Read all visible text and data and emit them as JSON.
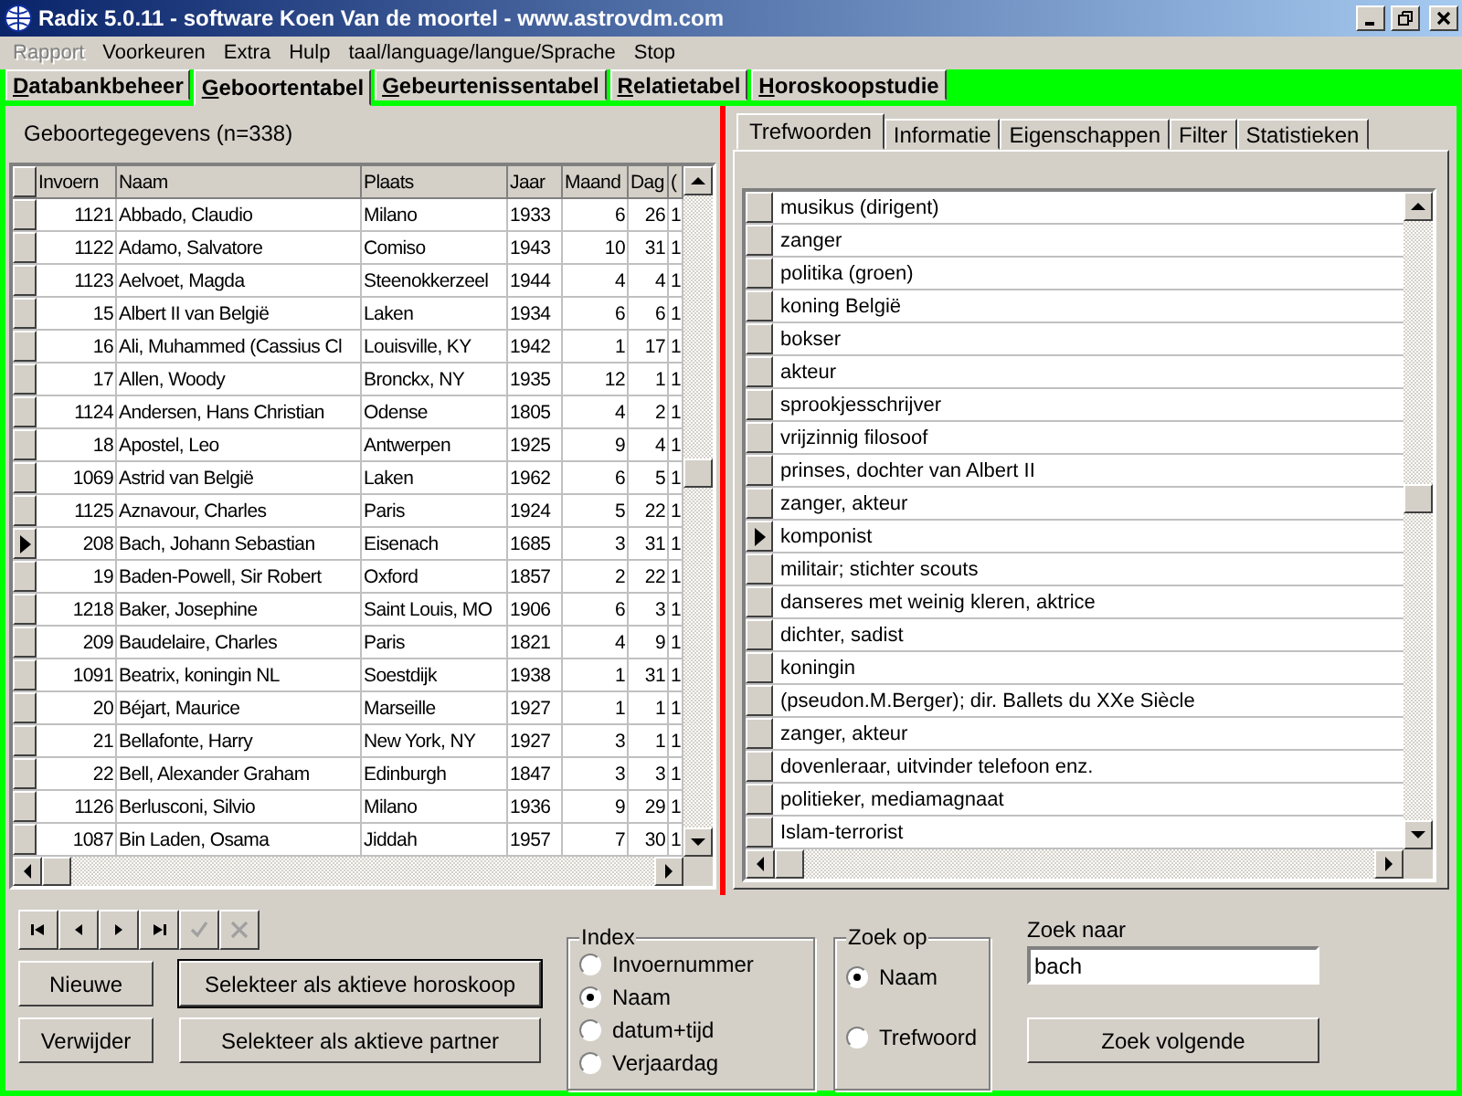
{
  "window": {
    "title": "Radix 5.0.11 - software Koen Van de moortel - www.astrovdm.com"
  },
  "menu": [
    {
      "label": "Rapport",
      "disabled": true
    },
    {
      "label": "Voorkeuren",
      "disabled": false
    },
    {
      "label": "Extra",
      "disabled": false
    },
    {
      "label": "Hulp",
      "disabled": false
    },
    {
      "label": "taal/language/langue/Sprache",
      "disabled": false
    },
    {
      "label": "Stop",
      "disabled": false
    }
  ],
  "main_tabs": [
    {
      "label": "Databankbeheer",
      "selected": false
    },
    {
      "label": "Geboortentabel",
      "selected": true
    },
    {
      "label": "Gebeurtenissentabel",
      "selected": false
    },
    {
      "label": "Relatietabel",
      "selected": false
    },
    {
      "label": "Horoskoopstudie",
      "selected": false
    }
  ],
  "birth_panel": {
    "title": "Geboortegegevens (n=338)",
    "columns": [
      "Invoern",
      "Naam",
      "Plaats",
      "Jaar",
      "Maand",
      "Dag",
      "("
    ],
    "rows": [
      {
        "selected": false,
        "cells": [
          "1121",
          "Abbado, Claudio",
          "Milano",
          "1933",
          "6",
          "26",
          "1"
        ]
      },
      {
        "selected": false,
        "cells": [
          "1122",
          "Adamo, Salvatore",
          "Comiso",
          "1943",
          "10",
          "31",
          "1"
        ]
      },
      {
        "selected": false,
        "cells": [
          "1123",
          "Aelvoet, Magda",
          "Steenokkerzeel",
          "1944",
          "4",
          "4",
          "1"
        ]
      },
      {
        "selected": false,
        "cells": [
          "15",
          "Albert II van België",
          "Laken",
          "1934",
          "6",
          "6",
          "1"
        ]
      },
      {
        "selected": false,
        "cells": [
          "16",
          "Ali, Muhammed (Cassius Cl",
          "Louisville, KY",
          "1942",
          "1",
          "17",
          "1"
        ]
      },
      {
        "selected": false,
        "cells": [
          "17",
          "Allen, Woody",
          "Bronckx, NY",
          "1935",
          "12",
          "1",
          "1"
        ]
      },
      {
        "selected": false,
        "cells": [
          "1124",
          "Andersen, Hans Christian",
          "Odense",
          "1805",
          "4",
          "2",
          "1"
        ]
      },
      {
        "selected": false,
        "cells": [
          "18",
          "Apostel, Leo",
          "Antwerpen",
          "1925",
          "9",
          "4",
          "1"
        ]
      },
      {
        "selected": false,
        "cells": [
          "1069",
          "Astrid van België",
          "Laken",
          "1962",
          "6",
          "5",
          "1"
        ]
      },
      {
        "selected": false,
        "cells": [
          "1125",
          "Aznavour, Charles",
          "Paris",
          "1924",
          "5",
          "22",
          "1"
        ]
      },
      {
        "selected": true,
        "cells": [
          "208",
          "Bach, Johann Sebastian",
          "Eisenach",
          "1685",
          "3",
          "31",
          "1"
        ]
      },
      {
        "selected": false,
        "cells": [
          "19",
          "Baden-Powell, Sir Robert",
          "Oxford",
          "1857",
          "2",
          "22",
          "1"
        ]
      },
      {
        "selected": false,
        "cells": [
          "1218",
          "Baker, Josephine",
          "Saint Louis, MO",
          "1906",
          "6",
          "3",
          "1"
        ]
      },
      {
        "selected": false,
        "cells": [
          "209",
          "Baudelaire, Charles",
          "Paris",
          "1821",
          "4",
          "9",
          "1"
        ]
      },
      {
        "selected": false,
        "cells": [
          "1091",
          "Beatrix, koningin NL",
          "Soestdijk",
          "1938",
          "1",
          "31",
          "1"
        ]
      },
      {
        "selected": false,
        "cells": [
          "20",
          "Béjart, Maurice",
          "Marseille",
          "1927",
          "1",
          "1",
          "1"
        ]
      },
      {
        "selected": false,
        "cells": [
          "21",
          "Bellafonte, Harry",
          "New York, NY",
          "1927",
          "3",
          "1",
          "1"
        ]
      },
      {
        "selected": false,
        "cells": [
          "22",
          "Bell, Alexander Graham",
          "Edinburgh",
          "1847",
          "3",
          "3",
          "1"
        ]
      },
      {
        "selected": false,
        "cells": [
          "1126",
          "Berlusconi, Silvio",
          "Milano",
          "1936",
          "9",
          "29",
          "1"
        ]
      },
      {
        "selected": false,
        "cells": [
          "1087",
          "Bin Laden, Osama",
          "Jiddah",
          "1957",
          "7",
          "30",
          "1"
        ]
      }
    ]
  },
  "keyword_panel": {
    "tabs": [
      {
        "label": "Trefwoorden",
        "selected": true
      },
      {
        "label": "Informatie",
        "selected": false
      },
      {
        "label": "Eigenschappen",
        "selected": false
      },
      {
        "label": "Filter",
        "selected": false
      },
      {
        "label": "Statistieken",
        "selected": false
      }
    ],
    "rows": [
      {
        "text": "musikus (dirigent)",
        "selected": false
      },
      {
        "text": "zanger",
        "selected": false
      },
      {
        "text": "politika (groen)",
        "selected": false
      },
      {
        "text": "koning België",
        "selected": false
      },
      {
        "text": "bokser",
        "selected": false
      },
      {
        "text": "akteur",
        "selected": false
      },
      {
        "text": "sprookjesschrijver",
        "selected": false
      },
      {
        "text": "vrijzinnig filosoof",
        "selected": false
      },
      {
        "text": "prinses, dochter van Albert II",
        "selected": false
      },
      {
        "text": "zanger, akteur",
        "selected": false
      },
      {
        "text": "komponist",
        "selected": true
      },
      {
        "text": "militair; stichter scouts",
        "selected": false
      },
      {
        "text": "danseres met weinig kleren, aktrice",
        "selected": false
      },
      {
        "text": "dichter, sadist",
        "selected": false
      },
      {
        "text": "koningin",
        "selected": false
      },
      {
        "text": "(pseudon.M.Berger); dir. Ballets du XXe Siècle",
        "selected": false
      },
      {
        "text": "zanger, akteur",
        "selected": false
      },
      {
        "text": "dovenleraar, uitvinder telefoon enz.",
        "selected": false
      },
      {
        "text": "politieker, mediamagnaat",
        "selected": false
      },
      {
        "text": "Islam-terrorist",
        "selected": false
      }
    ]
  },
  "navigator": [
    {
      "kind": "first",
      "disabled": false
    },
    {
      "kind": "prior",
      "disabled": false
    },
    {
      "kind": "next",
      "disabled": false
    },
    {
      "kind": "last",
      "disabled": false
    },
    {
      "kind": "post",
      "disabled": true
    },
    {
      "kind": "cancel",
      "disabled": true
    }
  ],
  "buttons": [
    {
      "label": "Nieuwe"
    },
    {
      "label": "Verwijder"
    },
    {
      "label": "Selekteer als aktieve horoskoop"
    },
    {
      "label": "Selekteer als aktieve partner"
    }
  ],
  "index_group": {
    "title": "Index",
    "options": [
      {
        "label": "Invoernummer",
        "selected": false
      },
      {
        "label": "Naam",
        "selected": true
      },
      {
        "label": "datum+tijd",
        "selected": false
      },
      {
        "label": "Verjaardag",
        "selected": false
      }
    ]
  },
  "search_by": {
    "title": "Zoek op",
    "options": [
      {
        "label": "Naam",
        "selected": true
      },
      {
        "label": "Trefwoord",
        "selected": false
      }
    ]
  },
  "search": {
    "label": "Zoek naar",
    "value": "bach",
    "button": "Zoek volgende"
  }
}
